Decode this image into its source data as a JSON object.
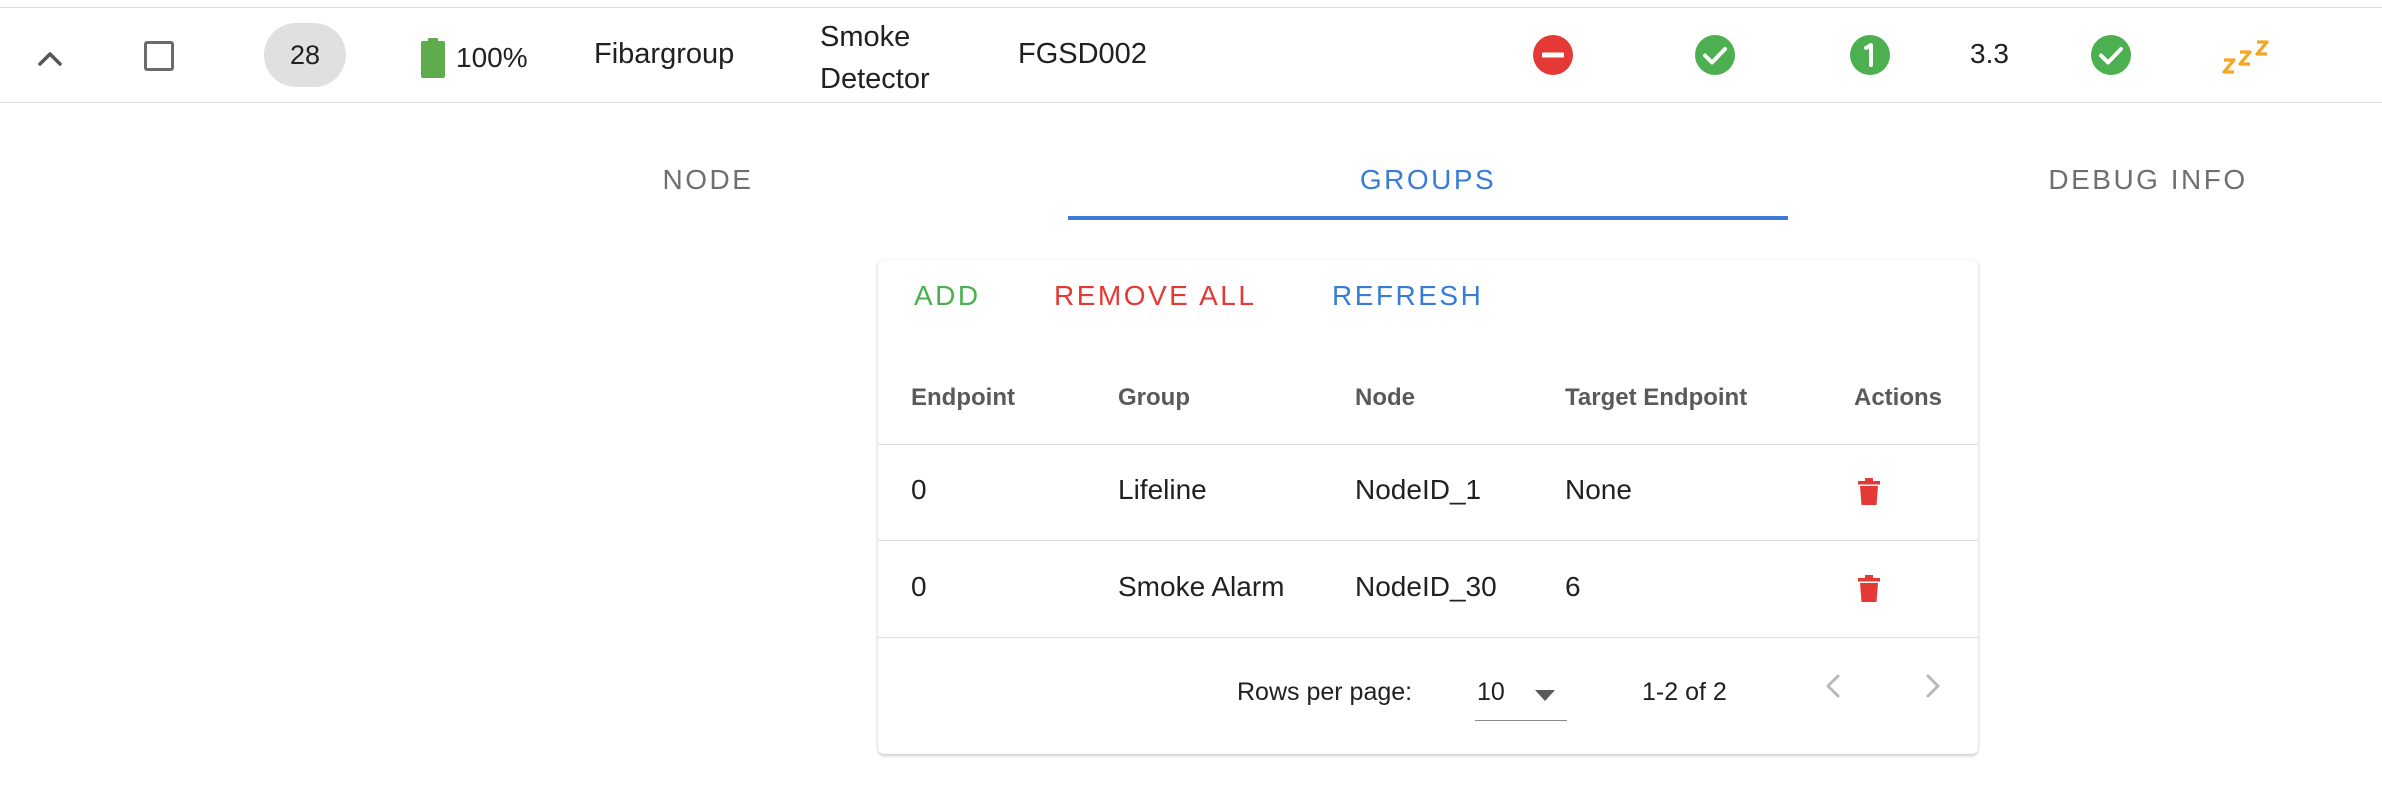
{
  "device": {
    "expand_icon": "chevron-up-icon",
    "node_id": "28",
    "battery": {
      "level_percent": 100,
      "text": "100%",
      "color": "#5fab4e"
    },
    "manufacturer": "Fibargroup",
    "product_line1": "Smoke",
    "product_line2": "Detector",
    "model": "FGSD002",
    "status_icons": [
      "forbidden-icon",
      "check-circle-icon",
      "info-circle-icon",
      "check-circle-icon",
      "sleep-icon"
    ],
    "version": "3.3",
    "colors": {
      "red": "#e53935",
      "green": "#4caf50",
      "orange": "#f5a623"
    }
  },
  "tabs": [
    {
      "label": "NODE",
      "active": false
    },
    {
      "label": "GROUPS",
      "active": true
    },
    {
      "label": "DEBUG INFO",
      "active": false
    }
  ],
  "groups": {
    "actions": {
      "add": "ADD",
      "remove_all": "REMOVE ALL",
      "refresh": "REFRESH"
    },
    "columns": [
      "Endpoint",
      "Group",
      "Node",
      "Target Endpoint",
      "Actions"
    ],
    "rows": [
      {
        "endpoint": "0",
        "group": "Lifeline",
        "node": "NodeID_1",
        "target_endpoint": "None"
      },
      {
        "endpoint": "0",
        "group": "Smoke Alarm",
        "node": "NodeID_30",
        "target_endpoint": "6"
      }
    ],
    "pagination": {
      "rows_per_page_label": "Rows per page:",
      "rows_per_page": "10",
      "range": "1-2 of 2"
    }
  },
  "accent_color": "#3a7bd5"
}
